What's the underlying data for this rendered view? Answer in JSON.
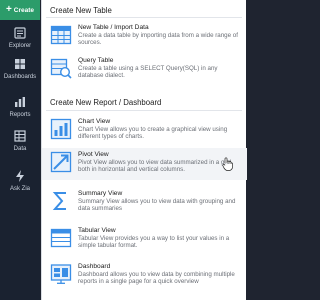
{
  "sidebar": {
    "create_label": "Create",
    "items": [
      {
        "label": "Explorer",
        "icon": "explorer-icon"
      },
      {
        "label": "Dashboards",
        "icon": "dashboards-icon"
      },
      {
        "label": "Reports",
        "icon": "reports-icon"
      },
      {
        "label": "Data",
        "icon": "data-icon"
      },
      {
        "label": "Ask Zia",
        "icon": "ask-zia-icon"
      }
    ]
  },
  "panel": {
    "table_section": {
      "title": "Create New Table",
      "items": [
        {
          "title": "New Table / Import Data",
          "desc": "Create a data table by importing data from a wide range of sources.",
          "icon": "new-table-icon"
        },
        {
          "title": "Query Table",
          "desc": "Create a table using a SELECT Query(SQL) in any database dialect.",
          "icon": "query-table-icon"
        }
      ]
    },
    "report_section": {
      "title": "Create New Report / Dashboard",
      "items": [
        {
          "title": "Chart View",
          "desc": "Chart View allows you to create a graphical view using different types of charts.",
          "icon": "chart-view-icon"
        },
        {
          "title": "Pivot View",
          "desc": "Pivot View allows you to view data summarized in a grid both in horizontal and vertical columns.",
          "icon": "pivot-view-icon"
        },
        {
          "title": "Summary View",
          "desc": "Summary View allows you to view data with grouping and data summaries",
          "icon": "summary-view-icon"
        },
        {
          "title": "Tabular View",
          "desc": "Tabular View provides you a way to list your values in a simple tabular format.",
          "icon": "tabular-view-icon"
        },
        {
          "title": "Dashboard",
          "desc": "Dashboard allows you to view data by combining multiple reports in a single page for a quick overview",
          "icon": "dashboard-icon"
        }
      ]
    }
  },
  "colors": {
    "sidebar_bg": "#1a2230",
    "create_button": "#2c9c6a",
    "icon_blue": "#3a8ee6",
    "panel_bg": "#ffffff"
  }
}
